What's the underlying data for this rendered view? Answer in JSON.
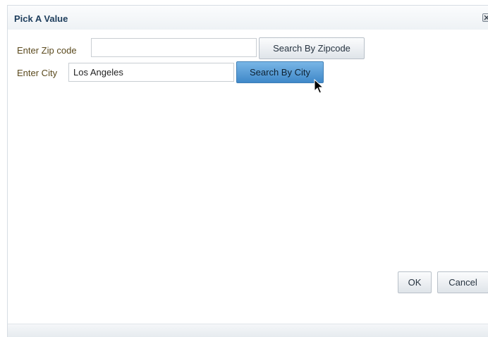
{
  "dialog": {
    "title": "Pick A Value",
    "close_icon": "close-icon"
  },
  "zip": {
    "label": "Enter Zip code",
    "value": "",
    "button_label": "Search By Zipcode"
  },
  "city": {
    "label": "Enter City",
    "value": "Los Angeles",
    "button_label": "Search By City"
  },
  "actions": {
    "ok_label": "OK",
    "cancel_label": "Cancel"
  },
  "colors": {
    "title": "#1d3d5c",
    "label": "#5b4a1e",
    "active_button": "#4a90cf"
  },
  "cursor_icon": "mouse-pointer-icon"
}
